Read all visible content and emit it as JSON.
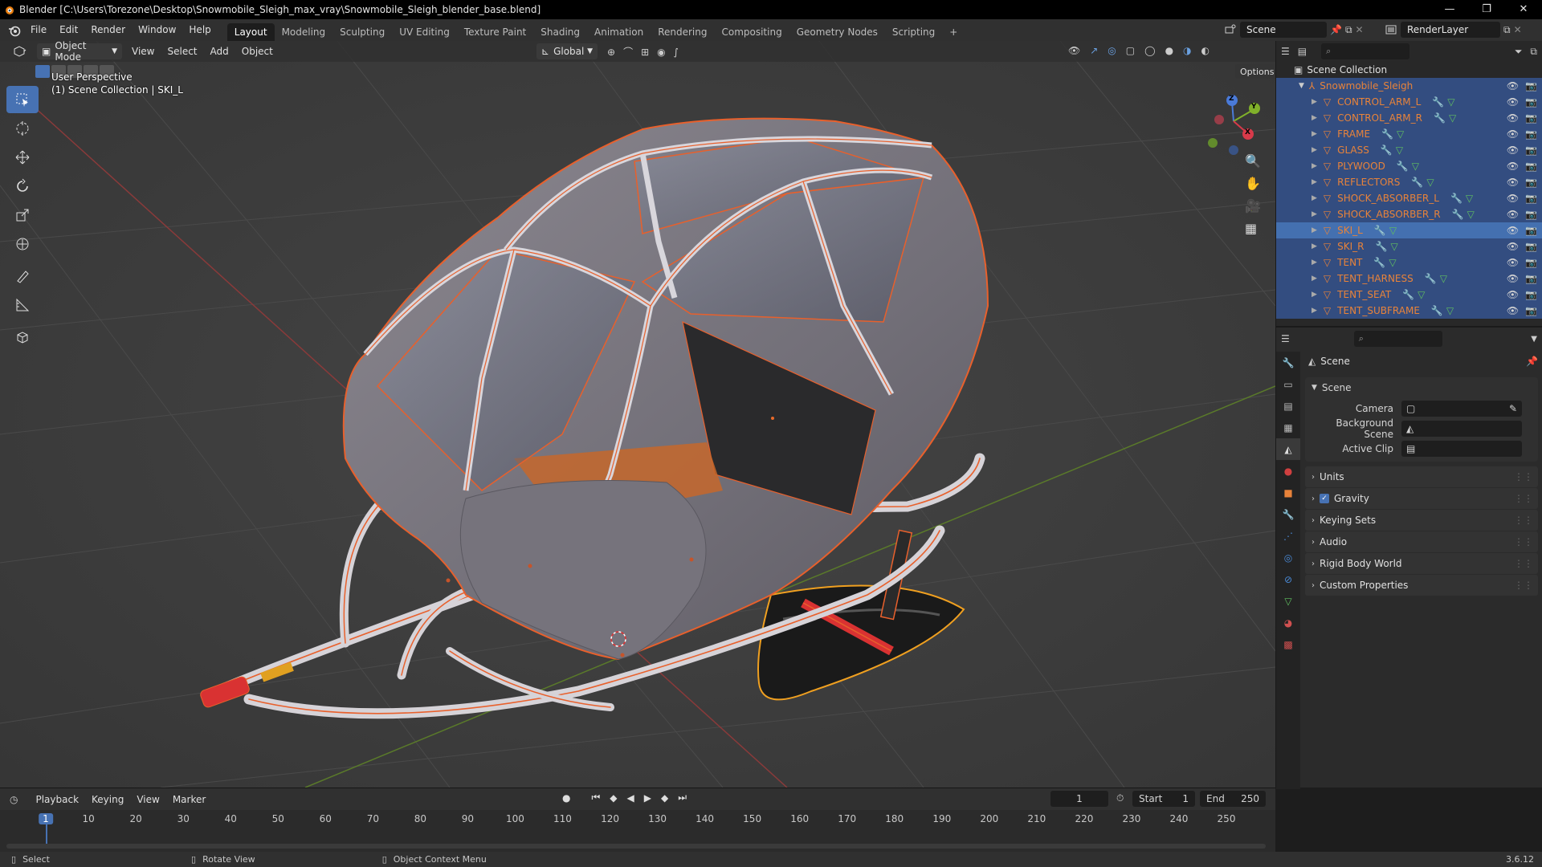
{
  "titlebar": {
    "title": "Blender [C:\\Users\\Torezone\\Desktop\\Snowmobile_Sleigh_max_vray\\Snowmobile_Sleigh_blender_base.blend]",
    "minimize": "—",
    "maximize": "❐",
    "close": "✕"
  },
  "menus": [
    "File",
    "Edit",
    "Render",
    "Window",
    "Help"
  ],
  "workspaces": [
    "Layout",
    "Modeling",
    "Sculpting",
    "UV Editing",
    "Texture Paint",
    "Shading",
    "Animation",
    "Rendering",
    "Compositing",
    "Geometry Nodes",
    "Scripting",
    "+"
  ],
  "scene_name": "Scene",
  "view_layer": "RenderLayer",
  "viewport": {
    "mode": "Object Mode",
    "menus": [
      "View",
      "Select",
      "Add",
      "Object"
    ],
    "orientation": "Global",
    "options": "Options",
    "perspective": "User Perspective",
    "collection_info": "(1) Scene Collection | SKI_L",
    "gizmo_axes": {
      "x": "X",
      "y": "Y",
      "z": "Z"
    }
  },
  "outliner": {
    "root": "Scene Collection",
    "parent": "Snowmobile_Sleigh",
    "objects": [
      {
        "name": "CONTROL_ARM_L",
        "selected": true
      },
      {
        "name": "CONTROL_ARM_R",
        "selected": true
      },
      {
        "name": "FRAME",
        "selected": true
      },
      {
        "name": "GLASS",
        "selected": true
      },
      {
        "name": "PLYWOOD",
        "selected": true
      },
      {
        "name": "REFLECTORS",
        "selected": true
      },
      {
        "name": "SHOCK_ABSORBER_L",
        "selected": true
      },
      {
        "name": "SHOCK_ABSORBER_R",
        "selected": true
      },
      {
        "name": "SKI_L",
        "selected": true,
        "active": true
      },
      {
        "name": "SKI_R",
        "selected": true
      },
      {
        "name": "TENT",
        "selected": true
      },
      {
        "name": "TENT_HARNESS",
        "selected": true
      },
      {
        "name": "TENT_SEAT",
        "selected": true
      },
      {
        "name": "TENT_SUBFRAME",
        "selected": true
      }
    ]
  },
  "properties": {
    "context": "Scene",
    "panel_title": "Scene",
    "fields": [
      {
        "label": "Camera"
      },
      {
        "label": "Background Scene"
      },
      {
        "label": "Active Clip"
      }
    ],
    "subpanels": [
      {
        "label": "Units"
      },
      {
        "label": "Gravity",
        "checked": true
      },
      {
        "label": "Keying Sets"
      },
      {
        "label": "Audio"
      },
      {
        "label": "Rigid Body World"
      },
      {
        "label": "Custom Properties"
      }
    ]
  },
  "timeline": {
    "menus": [
      "Playback",
      "Keying",
      "View",
      "Marker"
    ],
    "current_frame": "1",
    "start_label": "Start",
    "start": "1",
    "end_label": "End",
    "end": "250",
    "ticks": [
      "1",
      "10",
      "20",
      "30",
      "40",
      "50",
      "60",
      "70",
      "80",
      "90",
      "100",
      "110",
      "120",
      "130",
      "140",
      "150",
      "160",
      "170",
      "180",
      "190",
      "200",
      "210",
      "220",
      "230",
      "240",
      "250"
    ]
  },
  "statusbar": {
    "select": "Select",
    "rotate": "Rotate View",
    "context_menu": "Object Context Menu",
    "version": "3.6.12"
  },
  "colors": {
    "accent": "#4772b3",
    "selection_outline": "#e8602c",
    "object_name": "#e8833a"
  }
}
